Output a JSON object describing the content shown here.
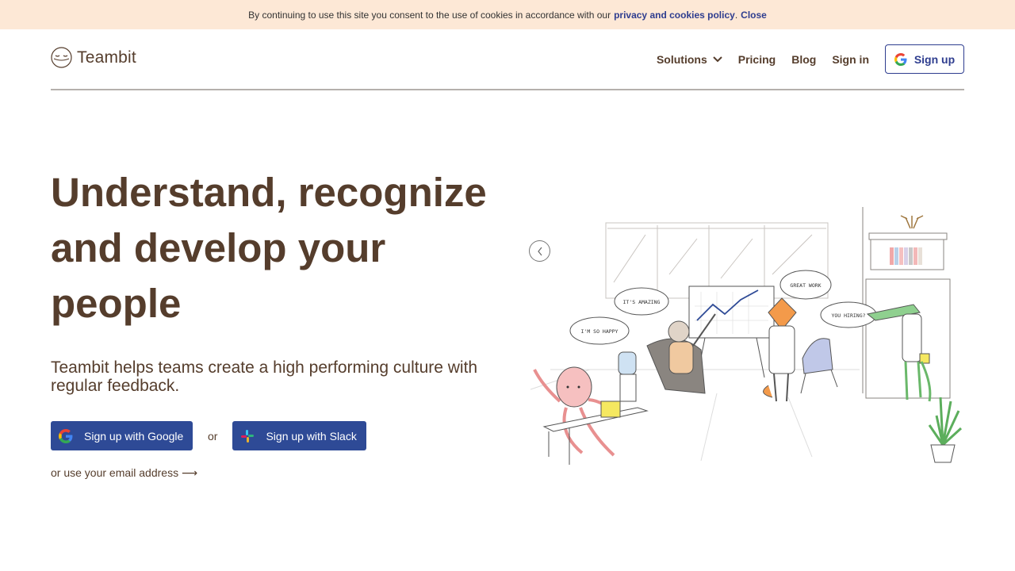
{
  "cookie": {
    "text": "By continuing to use this site you consent to the use of cookies in accordance with our",
    "link": "privacy and cookies policy",
    "period": ".",
    "close": "Close"
  },
  "brand": {
    "name": "Teambit",
    "logo_icon": "smiley-face-logo"
  },
  "nav": {
    "solutions": "Solutions",
    "pricing": "Pricing",
    "blog": "Blog",
    "signin": "Sign in",
    "signup": "Sign up"
  },
  "hero": {
    "title": "Understand, recognize and develop your people",
    "subtitle": "Teambit helps teams create a high performing culture with regular feedback.",
    "google_btn": "Sign up with Google",
    "or": "or",
    "slack_btn": "Sign up with Slack",
    "email_link": "or use your email address ⟶"
  },
  "illustration": {
    "bubbles": [
      "IT'S AMAZING",
      "I'M SO HAPPY",
      "GREAT WORK",
      "YOU HIRING?"
    ]
  },
  "colors": {
    "brand_brown": "#553d2c",
    "accent_blue": "#2e4a96",
    "cookie_bg": "#fde8d6"
  }
}
